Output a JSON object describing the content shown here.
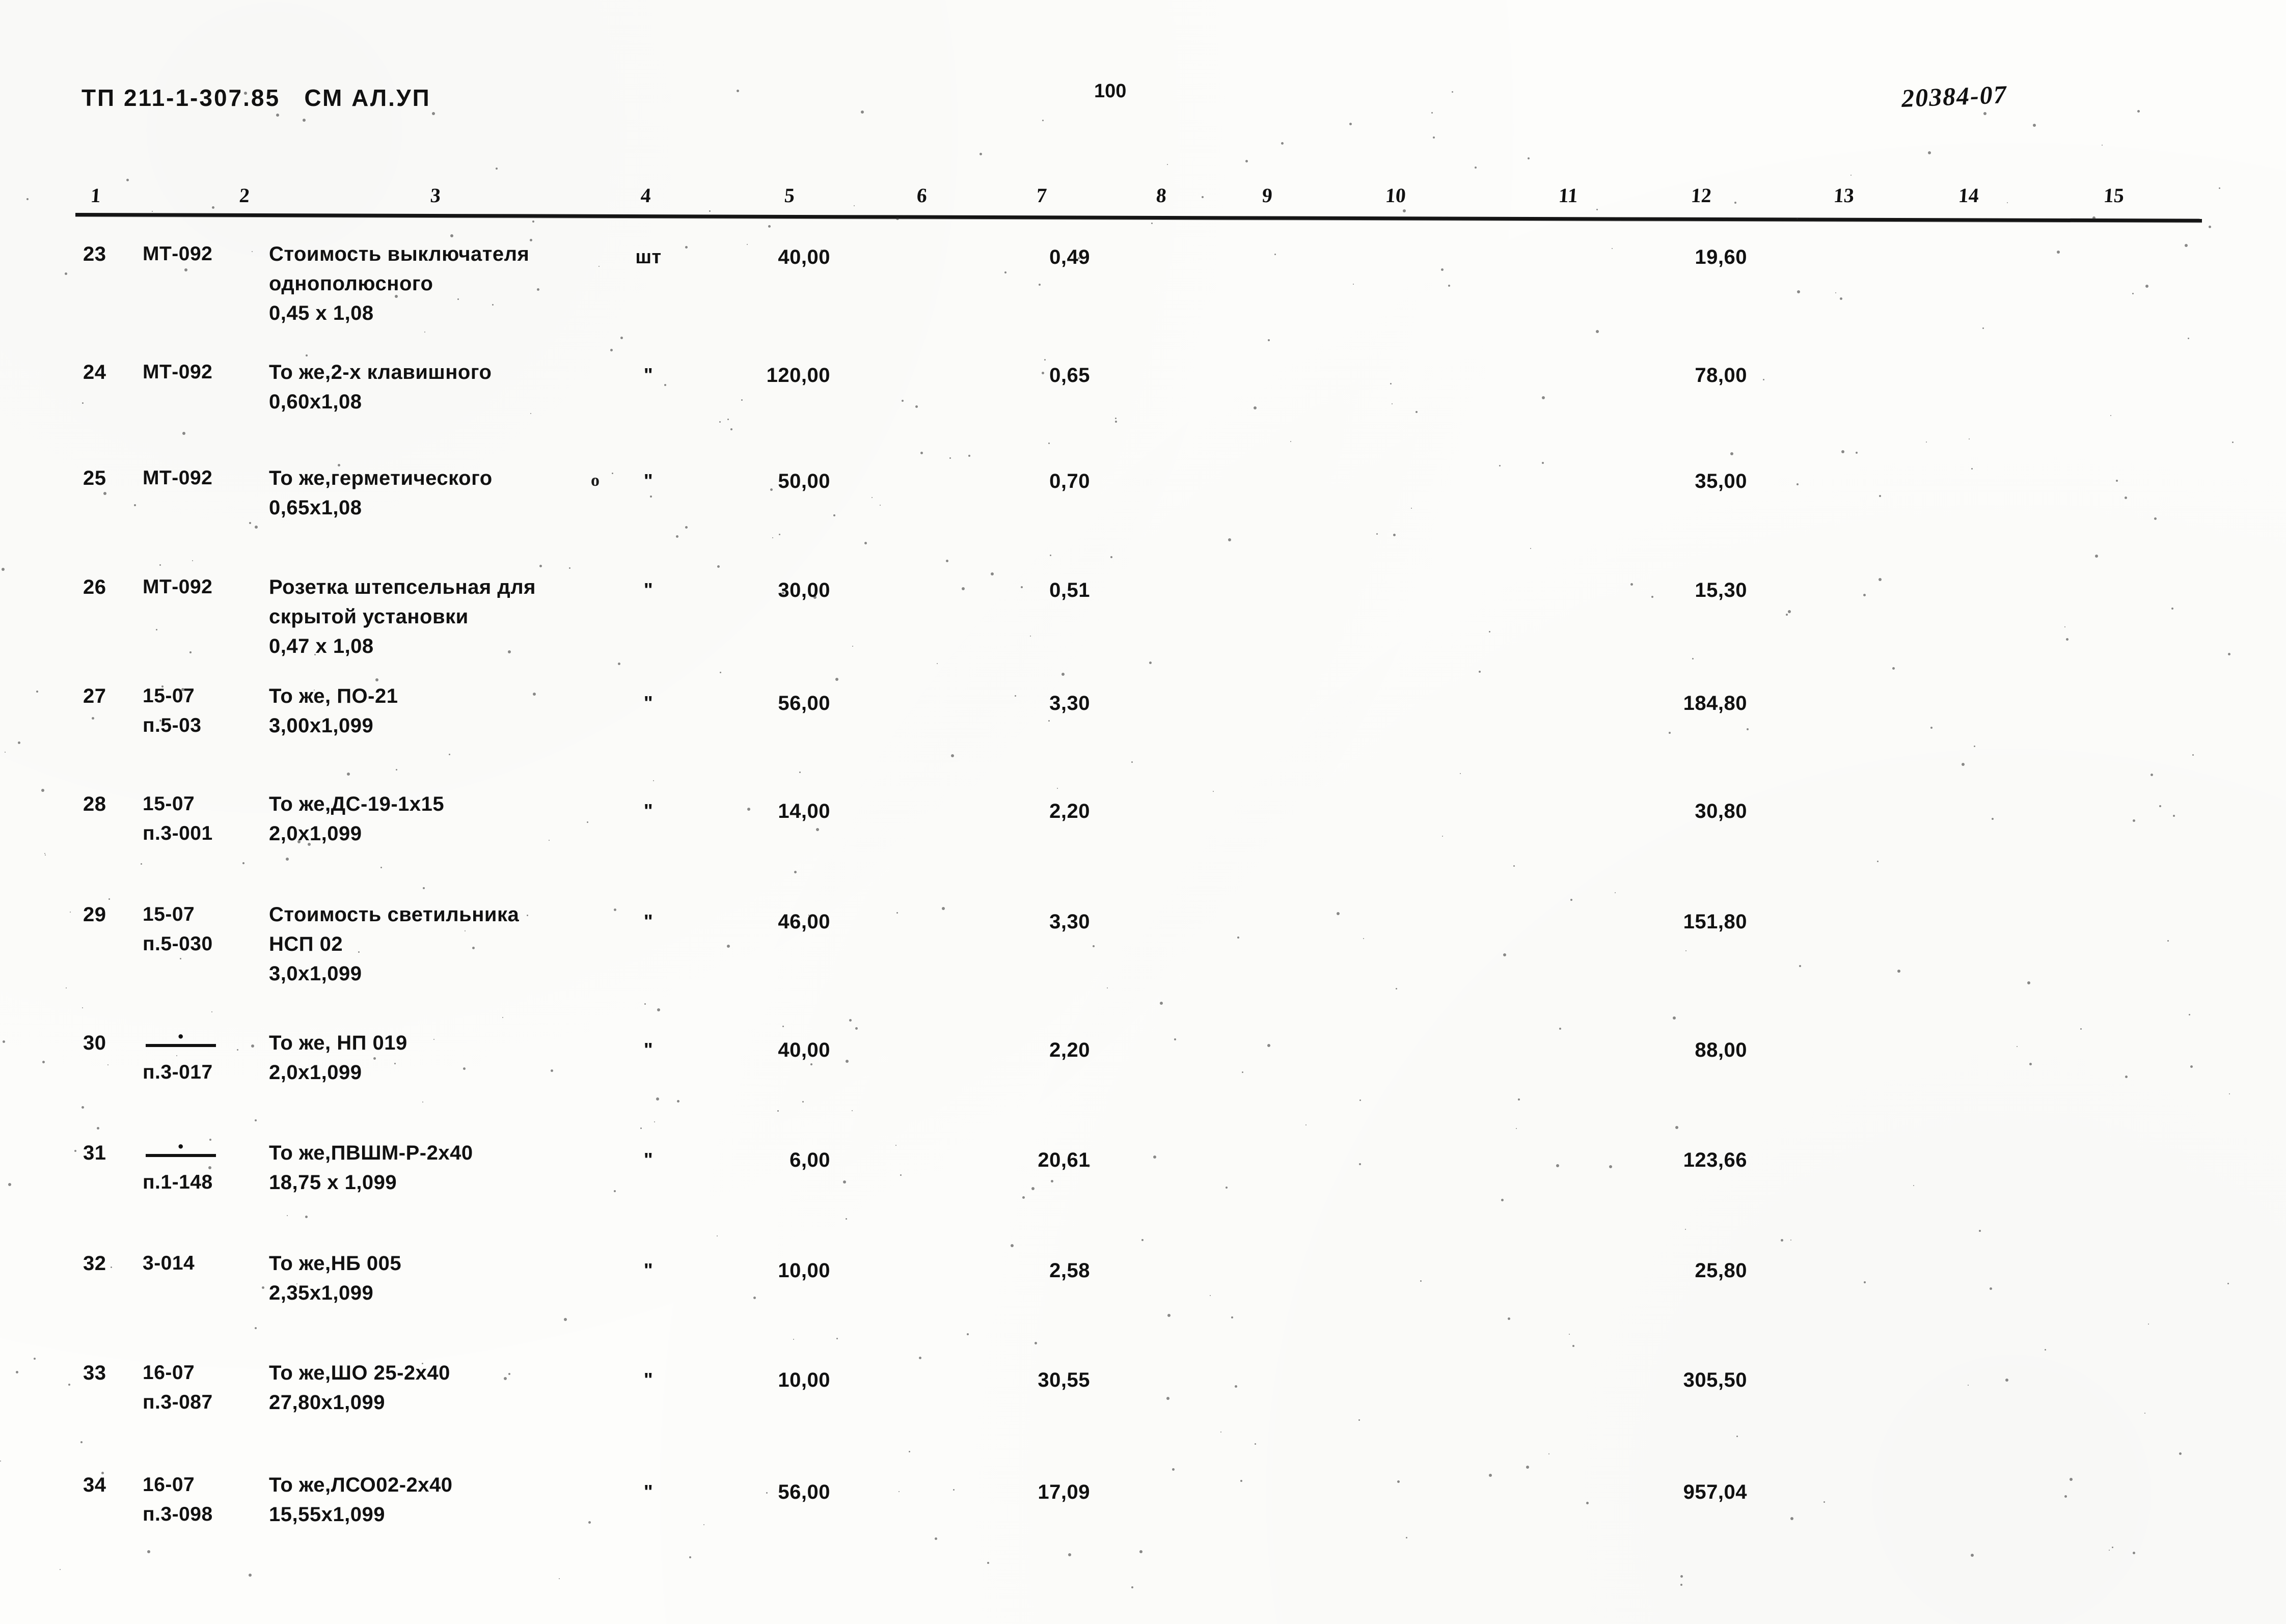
{
  "header": {
    "doc_code": "ТП 211-1-307.85   СМ АЛ.УП",
    "page_number": "100",
    "stamp_number": "20384-07"
  },
  "table": {
    "column_numbers": [
      "1",
      "2",
      "3",
      "4",
      "5",
      "6",
      "7",
      "8",
      "9",
      "10",
      "11",
      "12",
      "13",
      "14",
      "15"
    ],
    "rows": [
      {
        "no": "23",
        "code": "МТ-092",
        "desc_lines": [
          "Стоимость выключателя",
          "однополюсного",
          "0,45 х 1,08"
        ],
        "unit": "шт",
        "qty": "40,00",
        "price": "0,49",
        "total": "19,60"
      },
      {
        "no": "24",
        "code": "МТ-092",
        "desc_lines": [
          "То же,2-х клавишного",
          "0,60х1,08"
        ],
        "unit": "\"",
        "qty": "120,00",
        "price": "0,65",
        "total": "78,00"
      },
      {
        "no": "25",
        "code": "МТ-092",
        "desc_lines": [
          "То же,герметического",
          "0,65х1,08"
        ],
        "unit": "\"",
        "qty": "50,00",
        "price": "0,70",
        "total": "35,00"
      },
      {
        "no": "26",
        "code": "МТ-092",
        "desc_lines": [
          "Розетка штепсельная для",
          "скрытой установки",
          "0,47 х 1,08"
        ],
        "unit": "\"",
        "qty": "30,00",
        "price": "0,51",
        "total": "15,30"
      },
      {
        "no": "27",
        "code": "15-07",
        "code2": "п.5-03",
        "desc_lines": [
          "То же, ПО-21",
          "3,00х1,099"
        ],
        "unit": "\"",
        "qty": "56,00",
        "price": "3,30",
        "total": "184,80"
      },
      {
        "no": "28",
        "code": "15-07",
        "code2": "п.3-001",
        "desc_lines": [
          "То же,ДС-19-1х15",
          "2,0х1,099"
        ],
        "unit": "\"",
        "qty": "14,00",
        "price": "2,20",
        "total": "30,80"
      },
      {
        "no": "29",
        "code": "15-07",
        "code2": "п.5-030",
        "desc_lines": [
          "Стоимость светильника",
          "НСП 02",
          "3,0х1,099"
        ],
        "unit": "\"",
        "qty": "46,00",
        "price": "3,30",
        "total": "151,80"
      },
      {
        "no": "30",
        "code": "ditto",
        "code2": "п.3-017",
        "desc_lines": [
          "То же, НП 019",
          "2,0х1,099"
        ],
        "unit": "\"",
        "qty": "40,00",
        "price": "2,20",
        "total": "88,00"
      },
      {
        "no": "31",
        "code": "ditto",
        "code2": "п.1-148",
        "desc_lines": [
          "То же,ПВШМ-Р-2х40",
          "18,75 х 1,099"
        ],
        "unit": "\"",
        "qty": "6,00",
        "price": "20,61",
        "total": "123,66"
      },
      {
        "no": "32",
        "code": "3-014",
        "desc_lines": [
          "То же,НБ 005",
          "2,35х1,099"
        ],
        "unit": "\"",
        "qty": "10,00",
        "price": "2,58",
        "total": "25,80"
      },
      {
        "no": "33",
        "code": "16-07",
        "code2": "п.3-087",
        "desc_lines": [
          "То же,ШО 25-2х40",
          "27,80х1,099"
        ],
        "unit": "\"",
        "qty": "10,00",
        "price": "30,55",
        "total": "305,50"
      },
      {
        "no": "34",
        "code": "16-07",
        "code2": "п.3-098",
        "desc_lines": [
          "То же,ЛСО02-2х40",
          "15,55х1,099"
        ],
        "unit": "\"",
        "qty": "56,00",
        "price": "17,09",
        "total": "957,04"
      }
    ]
  }
}
